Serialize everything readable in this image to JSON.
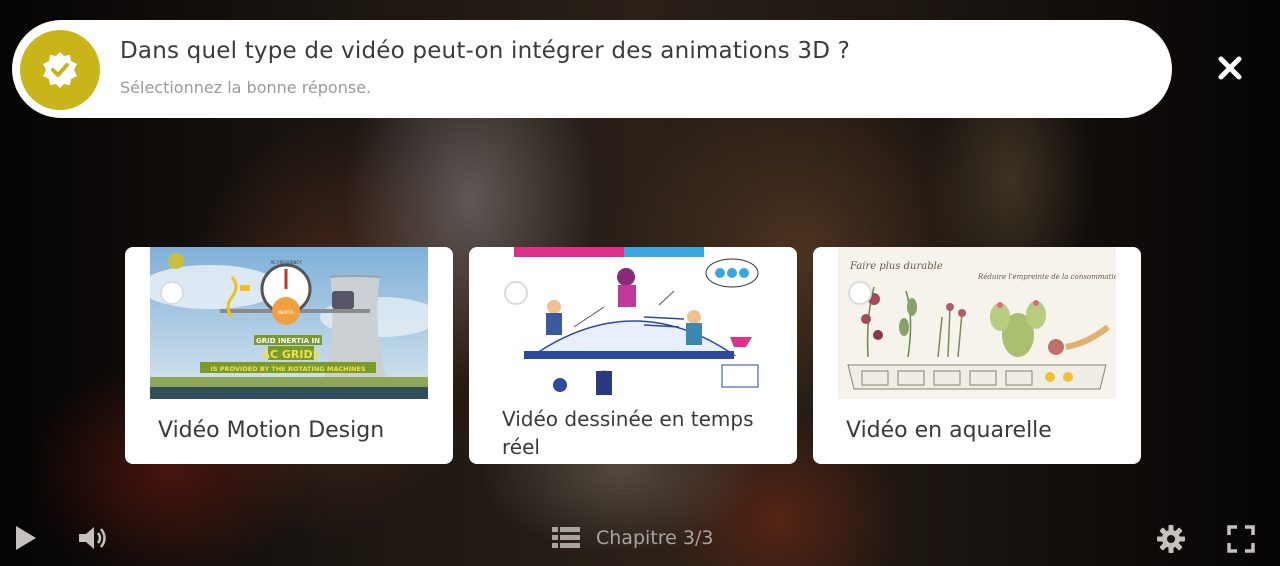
{
  "question": {
    "title": "Dans quel type de vidéo peut-on intégrer des animations 3D ?",
    "subtitle": "Sélectionnez la bonne réponse."
  },
  "answers": [
    {
      "label": "Vidéo Motion Design",
      "image": "grid-inertia-motion-design-thumbnail",
      "thumb_text": {
        "gauge_label": "AC FREQUENCY",
        "center_label": "INERTIA",
        "line1": "GRID INERTIA IN",
        "line2": "AC GRIDS",
        "line3": "IS PROVIDED BY THE ROTATING MACHINES"
      }
    },
    {
      "label": "Vidéo dessinée en temps réel",
      "image": "hand-drawn-sketch-thumbnail"
    },
    {
      "label": "Vidéo en aquarelle",
      "image": "watercolor-plants-thumbnail",
      "thumb_text": {
        "script1": "Faire plus durable",
        "script2": "Réduire l'empreinte de la consommation"
      }
    }
  ],
  "controls": {
    "chapter": "Chapitre 3/3"
  },
  "colors": {
    "badge": "#c9b51a",
    "card_bg": "#ffffff",
    "controls": "#b8b4b0"
  },
  "icons": [
    "check-badge-icon",
    "close-icon",
    "play-icon",
    "volume-icon",
    "list-icon",
    "gear-icon",
    "fullscreen-icon"
  ]
}
